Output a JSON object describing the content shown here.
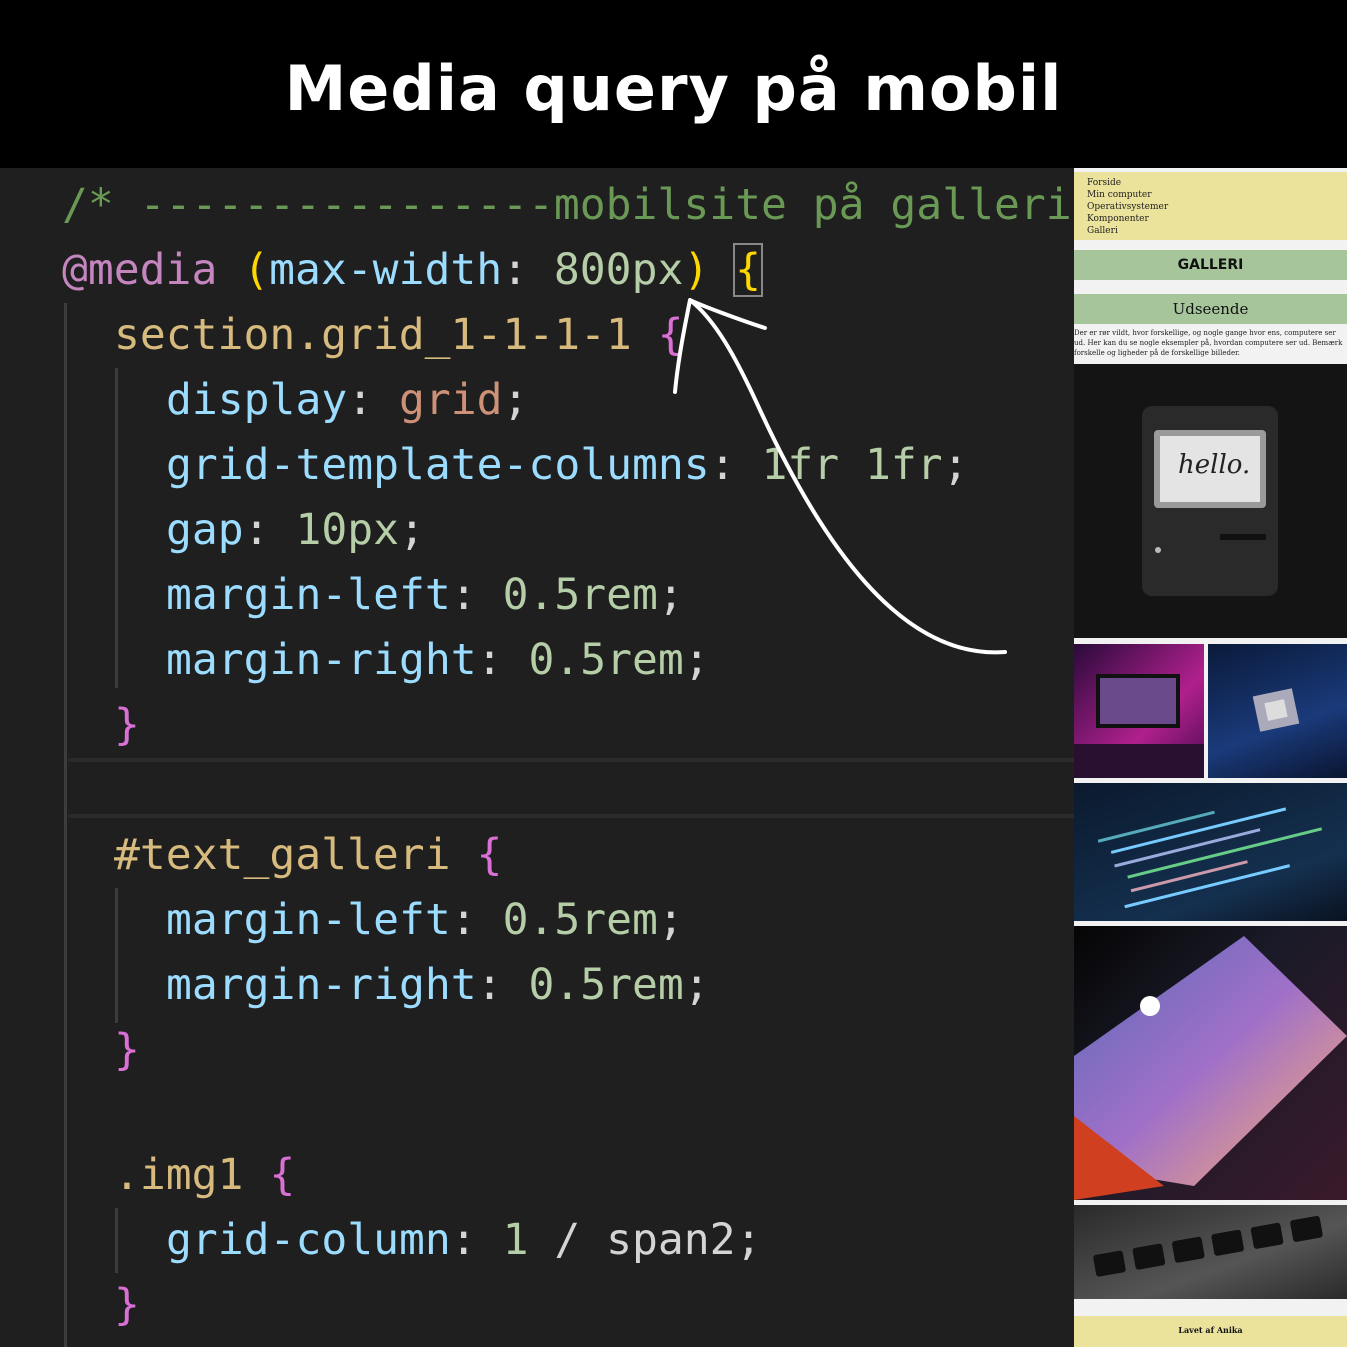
{
  "header": {
    "title": "Media query på mobil"
  },
  "code": {
    "l1": "/* ----------------mobilsite på galleri",
    "l2_at": "@media",
    "l2_open": "(",
    "l2_prop": "max-width",
    "l2_colon": ": ",
    "l2_num": "800px",
    "l2_close": ")",
    "l2_brace": "{",
    "l3_sel": "section.grid_1-1-1-1",
    "l3_brace": "{",
    "l4_prop": "display",
    "l4_val": "grid",
    "l5_prop": "grid-template-columns",
    "l5_val": "1fr 1fr",
    "l6_prop": "gap",
    "l6_val": "10px",
    "l7_prop": "margin-left",
    "l7_val": "0.5rem",
    "l8_prop": "margin-right",
    "l8_val": "0.5rem",
    "close": "}",
    "l11_sel": "#text_galleri",
    "l11_brace": "{",
    "l12_prop": "margin-left",
    "l12_val": "0.5rem",
    "l13_prop": "margin-right",
    "l13_val": "0.5rem",
    "l15_sel": ".img1",
    "l15_brace": "{",
    "l16_prop": "grid-column",
    "l16_val1": "1",
    "l16_slash": " / ",
    "l16_val2": "span2",
    "colon": ": ",
    "semi": ";"
  },
  "preview": {
    "nav": [
      "Forside",
      "Min computer",
      "Operativsystemer",
      "Komponenter",
      "Galleri"
    ],
    "galleri_heading": "GALLERI",
    "udseende_heading": "Udseende",
    "body_text": "Der er rør vildt, hvor forskellige, og nogle gange hvor ens, computere ser ud. Her kan du se nogle eksempler på, hvordan computere ser ud. Bemærk forskelle og ligheder på de forskellige billeder.",
    "hello_text": "hello.",
    "footer": "Lavet af Anika"
  },
  "colors": {
    "editor_bg": "#1f1f1f",
    "comment": "#6a9955",
    "property": "#9cdcfe",
    "number": "#b5cea8",
    "selector": "#d7ba7d",
    "nav_bg": "#ebe29c",
    "band_bg": "#a7c59a"
  }
}
